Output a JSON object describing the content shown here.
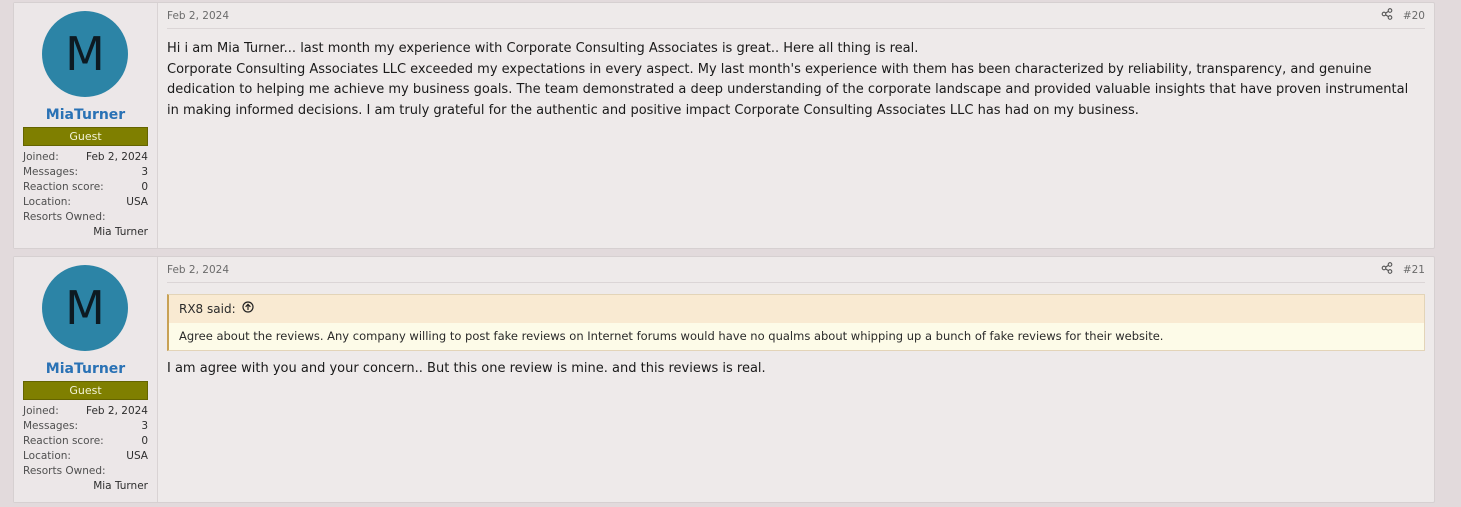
{
  "posts": [
    {
      "avatar_letter": "M",
      "username": "MiaTurner",
      "badge": "Guest",
      "stats": {
        "joined_label": "Joined:",
        "joined": "Feb 2, 2024",
        "messages_label": "Messages:",
        "messages": "3",
        "reaction_label": "Reaction score:",
        "reaction": "0",
        "location_label": "Location:",
        "location": "USA",
        "resorts_label": "Resorts Owned:",
        "resorts": "Mia Turner"
      },
      "date": "Feb 2, 2024",
      "number": "#20",
      "paragraphs": [
        "Hi i am Mia Turner... last month my experience with Corporate Consulting Associates is great.. Here all thing is real.",
        "Corporate Consulting Associates LLC exceeded my expectations in every aspect. My last month's experience with them has been characterized by reliability, transparency, and genuine dedication to helping me achieve my business goals. The team demonstrated a deep understanding of the corporate landscape and provided valuable insights that have proven instrumental in making informed decisions. I am truly grateful for the authentic and positive impact Corporate Consulting Associates LLC has had on my business."
      ]
    },
    {
      "avatar_letter": "M",
      "username": "MiaTurner",
      "badge": "Guest",
      "stats": {
        "joined_label": "Joined:",
        "joined": "Feb 2, 2024",
        "messages_label": "Messages:",
        "messages": "3",
        "reaction_label": "Reaction score:",
        "reaction": "0",
        "location_label": "Location:",
        "location": "USA",
        "resorts_label": "Resorts Owned:",
        "resorts": "Mia Turner"
      },
      "date": "Feb 2, 2024",
      "number": "#21",
      "quote": {
        "author": "RX8 said:",
        "text": "Agree about the reviews. Any company willing to post fake reviews on Internet forums would have no qualms about whipping up a bunch of fake reviews for their website."
      },
      "reply": "I am agree with you and your concern.. But this one review is mine. and this reviews is real."
    }
  ],
  "icons": {
    "share": "share-icon",
    "quote_jump": "arrow-up-circle-icon"
  },
  "colors": {
    "username": "#2a72b5",
    "badge": "#7f7f00",
    "avatar": "#2c84a6"
  }
}
